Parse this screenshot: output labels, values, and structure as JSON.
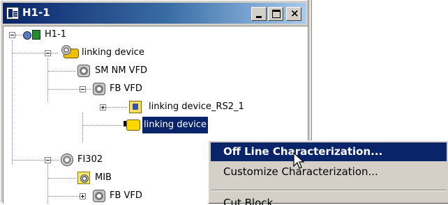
{
  "window": {
    "title": "H1-1"
  },
  "tree": {
    "root": "H1-1",
    "linking_device": "linking device",
    "sm_nm_vfd": "SM NM VFD",
    "fb_vfd_1": "FB VFD",
    "linking_device_rs2_1": "linking device_RS2_1",
    "linking_device_child": "linking device",
    "fi302": "FI302",
    "mib": "MIB",
    "fb_vfd_2": "FB VFD"
  },
  "context_menu": {
    "items": [
      {
        "label": "Off Line Characterization...",
        "selected": true
      },
      {
        "label": "Customize Characterization...",
        "selected": false
      },
      {
        "label": "Cut Block",
        "selected": false
      }
    ]
  },
  "colors": {
    "selection": "#0a246a",
    "face": "#d4d0c8"
  }
}
